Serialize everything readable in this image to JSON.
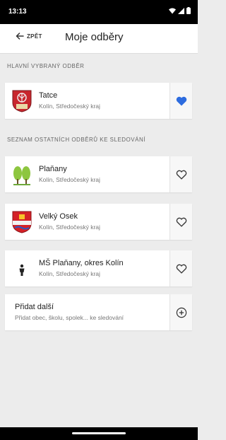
{
  "status": {
    "time": "13:13"
  },
  "header": {
    "back_label": "ZPĚT",
    "title": "Moje odběry"
  },
  "main_section": {
    "label": "HLAVNÍ VYBRANÝ ODBĚR",
    "item": {
      "name": "Tatce",
      "region": "Kolín, Středočeský kraj",
      "favorite": true
    }
  },
  "other_section": {
    "label": "SEZNAM OSTATNÍCH ODBĚRŮ KE SLEDOVÁNÍ",
    "items": [
      {
        "name": "Plaňany",
        "region": "Kolín, Středočeský kraj",
        "icon": "trees-emblem-icon"
      },
      {
        "name": "Velký Osek",
        "region": "Kolín, Středočeský kraj",
        "icon": "shield-emblem-icon"
      },
      {
        "name": "MŠ Plaňany, okres Kolín",
        "region": "Kolín, Středočeský kraj",
        "icon": "person-icon"
      }
    ]
  },
  "add_card": {
    "title": "Přidat další",
    "subtitle": "Přidat obec, školu, spolek... ke sledování"
  },
  "colors": {
    "accent": "#2d6cdf",
    "card": "#ffffff",
    "background": "#ececec"
  }
}
